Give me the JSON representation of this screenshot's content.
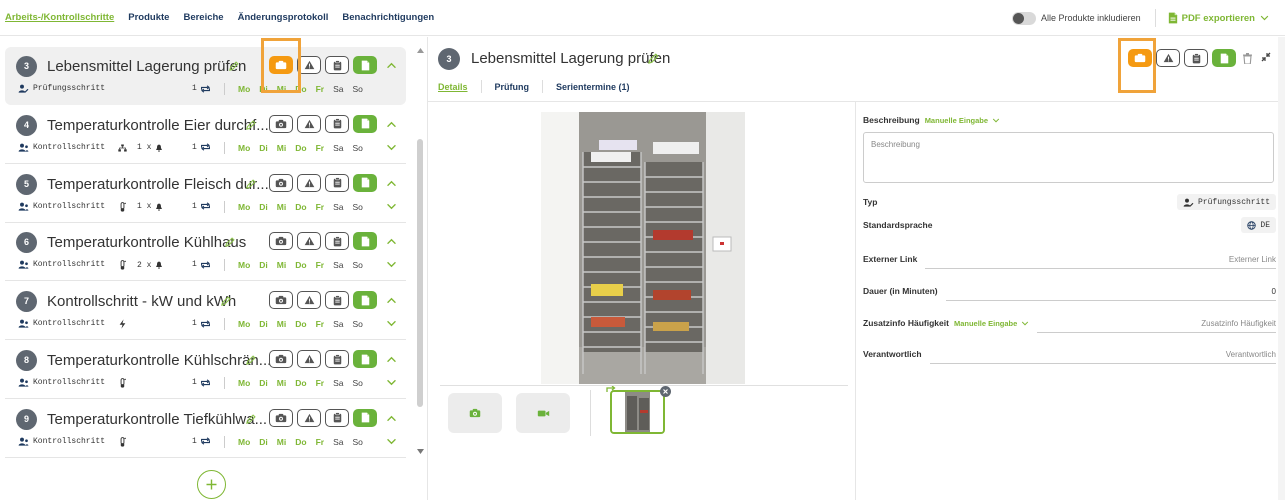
{
  "nav": {
    "items": [
      "Arbeits-/Kontrollschritte",
      "Produkte",
      "Bereiche",
      "Änderungsprotokoll",
      "Benachrichtigungen"
    ],
    "active_index": 0
  },
  "topright": {
    "toggle_label": "Alle Produkte inkludieren",
    "pdf_label": "PDF exportieren"
  },
  "steps": [
    {
      "number": "3",
      "title": "Lebensmittel Lagerung prüfen",
      "tag": "Prüfungsschritt",
      "extra_icon": "",
      "extra_text": "",
      "repeat": "1",
      "selected": true
    },
    {
      "number": "4",
      "title": "Temperaturkontrolle Eier durchf...",
      "tag": "Kontrollschritt",
      "extra_icon": "sitemap-icon",
      "extra_text": "1 x",
      "repeat": "1",
      "selected": false
    },
    {
      "number": "5",
      "title": "Temperaturkontrolle Fleisch dur...",
      "tag": "Kontrollschritt",
      "extra_icon": "thermometer-icon",
      "extra_text": "1 x",
      "repeat": "1",
      "selected": false
    },
    {
      "number": "6",
      "title": "Temperaturkontrolle Kühlhaus",
      "tag": "Kontrollschritt",
      "extra_icon": "thermometer-icon",
      "extra_text": "2 x",
      "repeat": "1",
      "selected": false
    },
    {
      "number": "7",
      "title": "Kontrollschritt - kW und kWh",
      "tag": "Kontrollschritt",
      "extra_icon": "bolt-icon",
      "extra_text": "",
      "repeat": "1",
      "selected": false
    },
    {
      "number": "8",
      "title": "Temperaturkontrolle Kühlschrän...",
      "tag": "Kontrollschritt",
      "extra_icon": "thermometer-icon",
      "extra_text": "",
      "repeat": "1",
      "selected": false
    },
    {
      "number": "9",
      "title": "Temperaturkontrolle Tiefkühlwa...",
      "tag": "Kontrollschritt",
      "extra_icon": "thermometer-icon",
      "extra_text": "",
      "repeat": "1",
      "selected": false
    }
  ],
  "weekdays": [
    "Mo",
    "Di",
    "Mi",
    "Do",
    "Fr",
    "Sa",
    "So"
  ],
  "weekday_active": [
    true,
    true,
    true,
    true,
    true,
    false,
    false
  ],
  "detail": {
    "number": "3",
    "title": "Lebensmittel Lagerung prüfen",
    "tabs": [
      "Details",
      "Prüfung",
      "Serientermine (1)"
    ],
    "active_tab": 0
  },
  "form": {
    "beschreibung_label": "Beschreibung",
    "beschreibung_mode": "Manuelle Eingabe",
    "beschreibung_placeholder": "Beschreibung",
    "typ_label": "Typ",
    "typ_value": "Prüfungsschritt",
    "sprache_label": "Standardsprache",
    "sprache_value": "DE",
    "link_label": "Externer Link",
    "link_placeholder": "Externer Link",
    "dauer_label": "Dauer (in Minuten)",
    "dauer_value": "0",
    "zusatz_label": "Zusatzinfo Häufigkeit",
    "zusatz_mode": "Manuelle Eingabe",
    "zusatz_placeholder": "Zusatzinfo Häufigkeit",
    "verantwortlich_label": "Verantwortlich",
    "verantwortlich_placeholder": "Verantwortlich"
  },
  "colors": {
    "accent_green": "#7fb734",
    "button_green": "#6ab23b",
    "highlight_orange": "#f59a12",
    "navy": "#1f3a5f",
    "badge_gray": "#5f6771"
  }
}
